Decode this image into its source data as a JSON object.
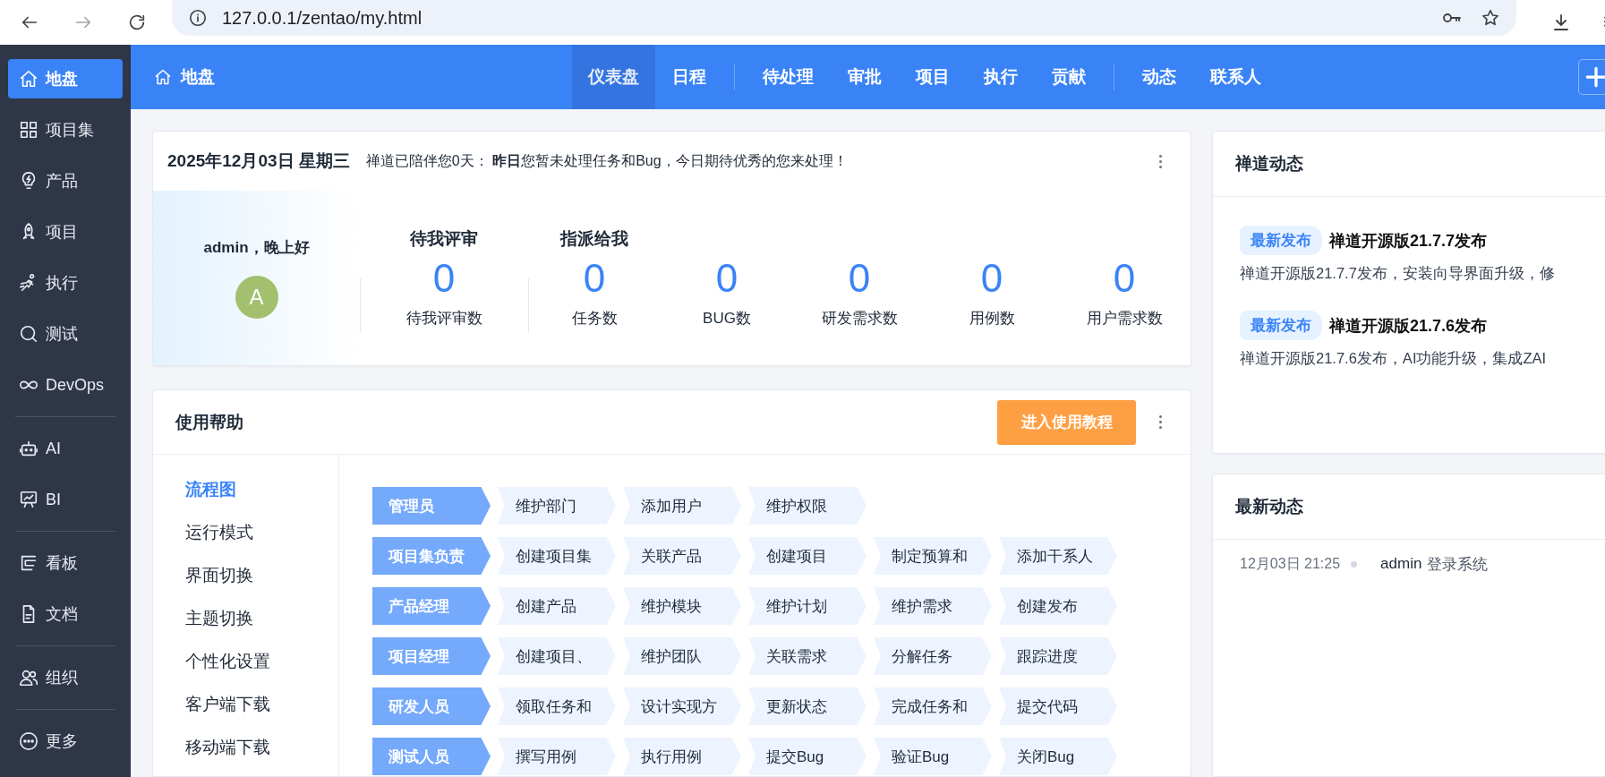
{
  "browser": {
    "url": "127.0.0.1/zentao/my.html"
  },
  "sidebar": {
    "groups": [
      [
        {
          "label": "地盘",
          "selected": true
        },
        {
          "label": "项目集",
          "selected": false
        },
        {
          "label": "产品",
          "selected": false
        },
        {
          "label": "项目",
          "selected": false
        },
        {
          "label": "执行",
          "selected": false
        },
        {
          "label": "测试",
          "selected": false
        },
        {
          "label": "DevOps",
          "selected": false
        }
      ],
      [
        {
          "label": "AI",
          "selected": false
        },
        {
          "label": "BI",
          "selected": false
        }
      ],
      [
        {
          "label": "看板",
          "selected": false
        },
        {
          "label": "文档",
          "selected": false
        }
      ],
      [
        {
          "label": "组织",
          "selected": false
        }
      ],
      [
        {
          "label": "更多",
          "selected": false
        }
      ]
    ]
  },
  "topbar": {
    "home": "地盘",
    "tab_groups": [
      [
        {
          "label": "仪表盘",
          "selected": true
        },
        {
          "label": "日程",
          "selected": false
        }
      ],
      [
        {
          "label": "待处理",
          "selected": false
        },
        {
          "label": "审批",
          "selected": false
        },
        {
          "label": "项目",
          "selected": false
        },
        {
          "label": "执行",
          "selected": false
        },
        {
          "label": "贡献",
          "selected": false
        }
      ],
      [
        {
          "label": "动态",
          "selected": false
        },
        {
          "label": "联系人",
          "selected": false
        }
      ]
    ]
  },
  "welcome": {
    "date": "2025年12月03日 星期三",
    "message": "禅道已陪伴您0天：  **昨日**您暂未处理任务和Bug，今日期待优秀的您来处理！",
    "greeting": "admin，晚上好",
    "avatar": "A",
    "stat_groups": [
      {
        "title": "待我评审",
        "stats": [
          {
            "value": "0",
            "label": "待我评审数"
          }
        ]
      },
      {
        "title": "指派给我",
        "stats": [
          {
            "value": "0",
            "label": "任务数"
          },
          {
            "value": "0",
            "label": "BUG数"
          },
          {
            "value": "0",
            "label": "研发需求数"
          },
          {
            "value": "0",
            "label": "用例数"
          },
          {
            "value": "0",
            "label": "用户需求数"
          }
        ]
      }
    ]
  },
  "help": {
    "title": "使用帮助",
    "button": "进入使用教程",
    "nav": [
      {
        "label": "流程图",
        "selected": true
      },
      {
        "label": "运行模式",
        "selected": false
      },
      {
        "label": "界面切换",
        "selected": false
      },
      {
        "label": "主题切换",
        "selected": false
      },
      {
        "label": "个性化设置",
        "selected": false
      },
      {
        "label": "客户端下载",
        "selected": false
      },
      {
        "label": "移动端下载",
        "selected": false
      }
    ],
    "flow": [
      {
        "role": "管理员",
        "steps": [
          "维护部门",
          "添加用户",
          "维护权限"
        ]
      },
      {
        "role": "项目集负责",
        "steps": [
          "创建项目集",
          "关联产品",
          "创建项目",
          "制定预算和",
          "添加干系人"
        ]
      },
      {
        "role": "产品经理",
        "steps": [
          "创建产品",
          "维护模块",
          "维护计划",
          "维护需求",
          "创建发布"
        ]
      },
      {
        "role": "项目经理",
        "steps": [
          "创建项目、",
          "维护团队",
          "关联需求",
          "分解任务",
          "跟踪进度"
        ]
      },
      {
        "role": "研发人员",
        "steps": [
          "领取任务和",
          "设计实现方",
          "更新状态",
          "完成任务和",
          "提交代码"
        ]
      },
      {
        "role": "测试人员",
        "steps": [
          "撰写用例",
          "执行用例",
          "提交Bug",
          "验证Bug",
          "关闭Bug"
        ]
      }
    ]
  },
  "news": {
    "title": "禅道动态",
    "items": [
      {
        "badge": "最新发布",
        "title": "禅道开源版21.7.7发布",
        "summary": "禅道开源版21.7.7发布，安装向导界面升级，修"
      },
      {
        "badge": "最新发布",
        "title": "禅道开源版21.7.6发布",
        "summary": "禅道开源版21.7.6发布，AI功能升级，集成ZAI"
      }
    ]
  },
  "activity": {
    "title": "最新动态",
    "items": [
      {
        "time": "12月03日 21:25",
        "actor": "admin",
        "action": "登录系统"
      }
    ]
  }
}
